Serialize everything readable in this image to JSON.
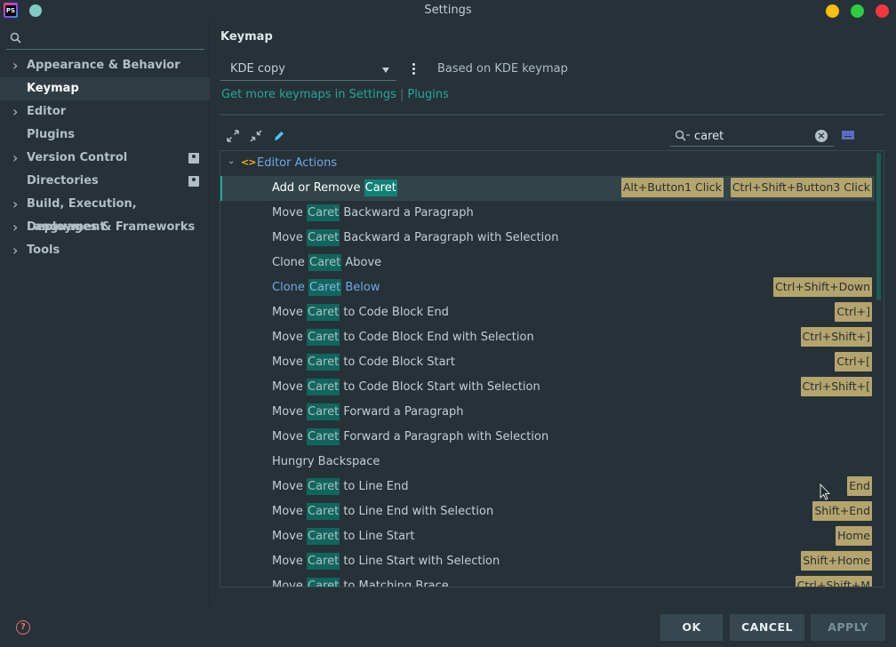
{
  "window": {
    "title": "Settings",
    "app_icon_text": "PS"
  },
  "sidebar": {
    "search": {
      "value": "",
      "placeholder": ""
    },
    "items": [
      {
        "label": "Appearance & Behavior",
        "expandable": true,
        "selected": false,
        "badge": false
      },
      {
        "label": "Keymap",
        "expandable": false,
        "selected": true,
        "badge": false
      },
      {
        "label": "Editor",
        "expandable": true,
        "selected": false,
        "badge": false
      },
      {
        "label": "Plugins",
        "expandable": false,
        "selected": false,
        "badge": false
      },
      {
        "label": "Version Control",
        "expandable": true,
        "selected": false,
        "badge": true
      },
      {
        "label": "Directories",
        "expandable": false,
        "selected": false,
        "badge": true
      },
      {
        "label": "Build, Execution, Deployment",
        "expandable": true,
        "selected": false,
        "badge": false
      },
      {
        "label": "Languages & Frameworks",
        "expandable": true,
        "selected": false,
        "badge": false
      },
      {
        "label": "Tools",
        "expandable": true,
        "selected": false,
        "badge": false
      }
    ]
  },
  "main": {
    "title": "Keymap",
    "scheme": {
      "selected": "KDE copy"
    },
    "based_on": "Based on KDE keymap",
    "get_more": {
      "prefix": "Get more keymaps in Settings",
      "separator": "|",
      "link": "Plugins"
    },
    "filter": {
      "value": "caret"
    },
    "group": {
      "label": "Editor Actions"
    },
    "highlight_word": "Caret",
    "actions": [
      {
        "before": "Add or Remove ",
        "after": "",
        "shortcuts": [
          "Alt+Button1 Click",
          "Ctrl+Shift+Button3 Click"
        ],
        "selected": true,
        "modified": false
      },
      {
        "before": "Move ",
        "after": " Backward a Paragraph",
        "shortcuts": [],
        "selected": false,
        "modified": false
      },
      {
        "before": "Move ",
        "after": " Backward a Paragraph with Selection",
        "shortcuts": [],
        "selected": false,
        "modified": false
      },
      {
        "before": "Clone ",
        "after": " Above",
        "shortcuts": [],
        "selected": false,
        "modified": false
      },
      {
        "before": "Clone ",
        "after": " Below",
        "shortcuts": [
          "Ctrl+Shift+Down"
        ],
        "selected": false,
        "modified": true
      },
      {
        "before": "Move ",
        "after": " to Code Block End",
        "shortcuts": [
          "Ctrl+]"
        ],
        "selected": false,
        "modified": false
      },
      {
        "before": "Move ",
        "after": " to Code Block End with Selection",
        "shortcuts": [
          "Ctrl+Shift+]"
        ],
        "selected": false,
        "modified": false
      },
      {
        "before": "Move ",
        "after": " to Code Block Start",
        "shortcuts": [
          "Ctrl+["
        ],
        "selected": false,
        "modified": false
      },
      {
        "before": "Move ",
        "after": " to Code Block Start with Selection",
        "shortcuts": [
          "Ctrl+Shift+["
        ],
        "selected": false,
        "modified": false
      },
      {
        "before": "Move ",
        "after": " Forward a Paragraph",
        "shortcuts": [],
        "selected": false,
        "modified": false
      },
      {
        "before": "Move ",
        "after": " Forward a Paragraph with Selection",
        "shortcuts": [],
        "selected": false,
        "modified": false
      },
      {
        "before": "Hungry Backspace",
        "after": null,
        "shortcuts": [],
        "selected": false,
        "modified": false
      },
      {
        "before": "Move ",
        "after": " to Line End",
        "shortcuts": [
          "End"
        ],
        "selected": false,
        "modified": false
      },
      {
        "before": "Move ",
        "after": " to Line End with Selection",
        "shortcuts": [
          "Shift+End"
        ],
        "selected": false,
        "modified": false
      },
      {
        "before": "Move ",
        "after": " to Line Start",
        "shortcuts": [
          "Home"
        ],
        "selected": false,
        "modified": false
      },
      {
        "before": "Move ",
        "after": " to Line Start with Selection",
        "shortcuts": [
          "Shift+Home"
        ],
        "selected": false,
        "modified": false
      },
      {
        "before": "Move ",
        "after": " to Matching Brace",
        "shortcuts": [
          "Ctrl+Shift+M"
        ],
        "selected": false,
        "modified": false
      }
    ],
    "toolbar_icons": [
      "expand-all-icon",
      "collapse-all-icon",
      "edit-icon"
    ]
  },
  "footer": {
    "help_label": "?",
    "ok": "OK",
    "cancel": "CANCEL",
    "apply": "APPLY"
  },
  "colors": {
    "background": "#263238",
    "accent": "#26a69a",
    "shortcut_bg": "#b5a46c",
    "link_blue": "#6fa8e8"
  }
}
